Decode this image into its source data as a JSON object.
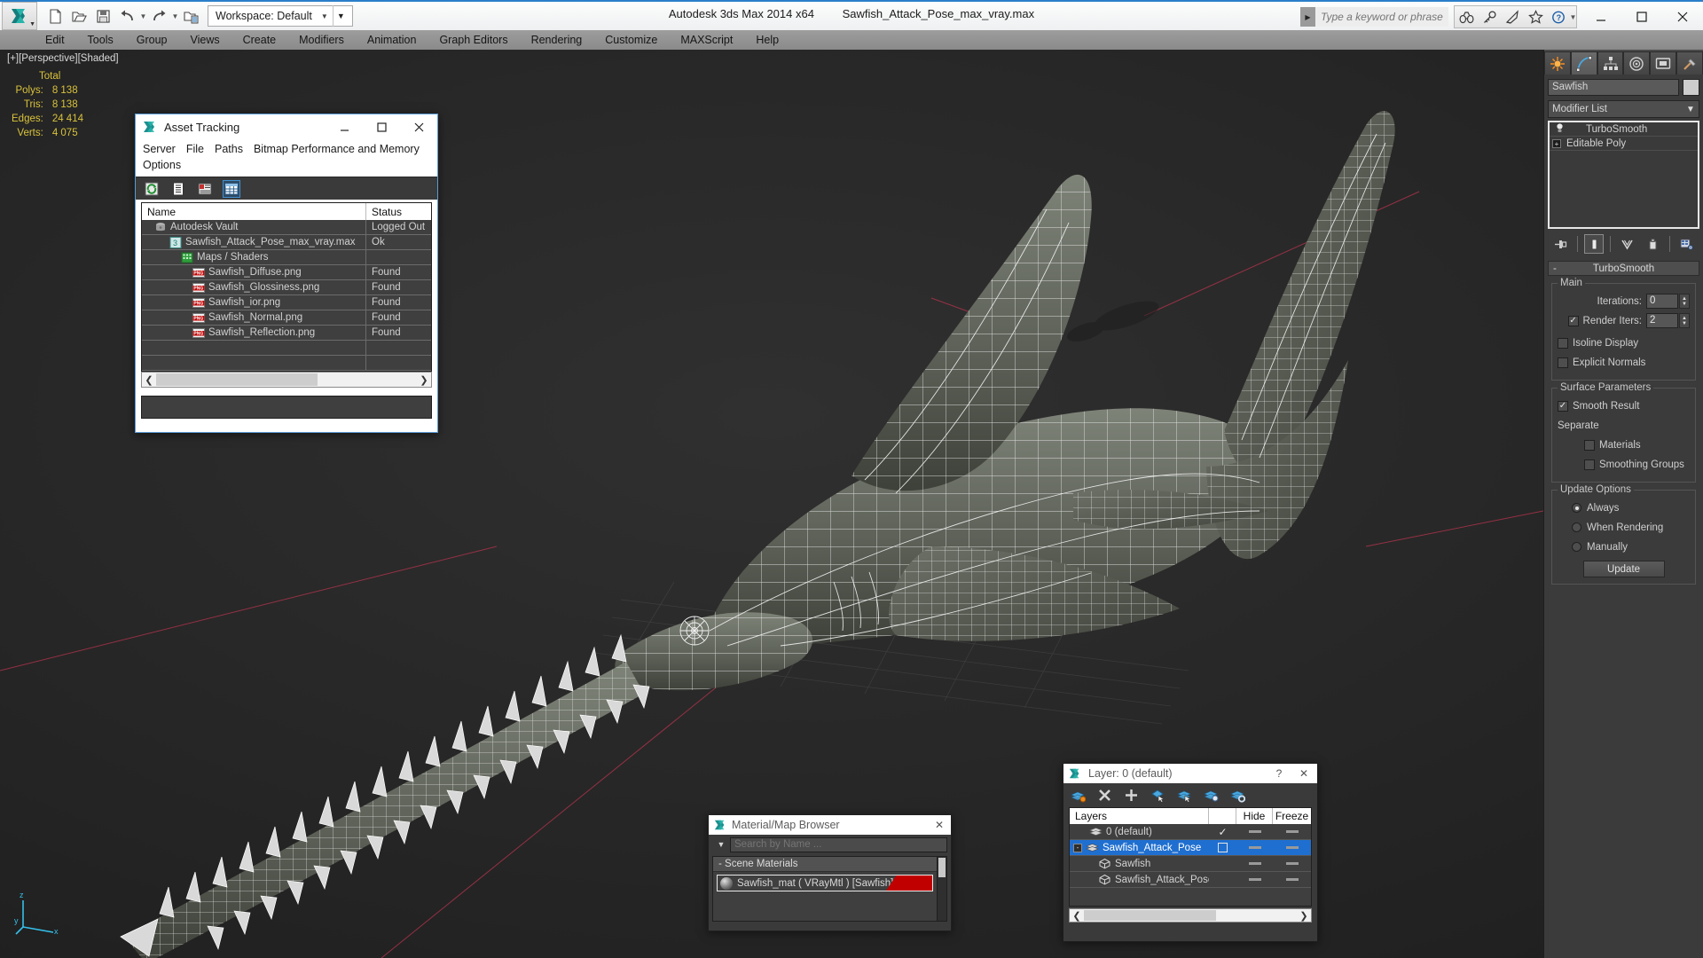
{
  "app": {
    "title": "Autodesk 3ds Max  2014 x64",
    "document": "Sawfish_Attack_Pose_max_vray.max",
    "workspace_label": "Workspace: Default",
    "search_placeholder": "Type a keyword or phrase"
  },
  "quick_access": [
    {
      "name": "new-file-icon",
      "label": "New"
    },
    {
      "name": "open-file-icon",
      "label": "Open"
    },
    {
      "name": "save-file-icon",
      "label": "Save"
    },
    {
      "name": "undo-icon",
      "label": "Undo"
    },
    {
      "name": "redo-icon",
      "label": "Redo"
    },
    {
      "name": "project-folder-icon",
      "label": "Set Project Folder"
    }
  ],
  "title_right_icons": [
    {
      "name": "binoculars-icon",
      "label": "Search"
    },
    {
      "name": "key-icon",
      "label": "Sign In"
    },
    {
      "name": "satellite-dish-icon",
      "label": "Autodesk 360"
    },
    {
      "name": "star-icon",
      "label": "Favorites"
    },
    {
      "name": "help-icon",
      "label": "Help"
    }
  ],
  "window_controls": [
    {
      "name": "minimize-button",
      "glyph": "minimize"
    },
    {
      "name": "maximize-button",
      "glyph": "maximize"
    },
    {
      "name": "close-button",
      "glyph": "close"
    }
  ],
  "menubar": {
    "items": [
      "Edit",
      "Tools",
      "Group",
      "Views",
      "Create",
      "Modifiers",
      "Animation",
      "Graph Editors",
      "Rendering",
      "Customize",
      "MAXScript",
      "Help"
    ]
  },
  "viewport": {
    "label": "[+][Perspective][Shaded]",
    "stats": {
      "header": "Total",
      "rows": [
        {
          "label": "Polys:",
          "value": "8 138"
        },
        {
          "label": "Tris:",
          "value": "8 138"
        },
        {
          "label": "Edges:",
          "value": "24 414"
        },
        {
          "label": "Verts:",
          "value": "4 075"
        }
      ]
    },
    "axis": {
      "x": "x",
      "y": "y",
      "z": "z"
    }
  },
  "asset_tracking": {
    "title": "Asset Tracking",
    "window_buttons": [
      "minimize",
      "maximize",
      "close"
    ],
    "menu": [
      "Server",
      "File",
      "Paths",
      "Bitmap Performance and Memory",
      "Options"
    ],
    "toolbar": [
      {
        "name": "refresh-icon",
        "selected": false
      },
      {
        "name": "list-view-icon",
        "selected": false
      },
      {
        "name": "detail-view-icon",
        "selected": false
      },
      {
        "name": "grid-view-icon",
        "selected": true
      }
    ],
    "columns": [
      "Name",
      "Status"
    ],
    "rows": [
      {
        "name": "Autodesk Vault",
        "status": "Logged Out",
        "icon": "vault-icon",
        "indent": 1
      },
      {
        "name": "Sawfish_Attack_Pose_max_vray.max",
        "status": "Ok",
        "icon": "max-file-icon",
        "indent": 2
      },
      {
        "name": "Maps / Shaders",
        "status": "",
        "icon": "maps-icon",
        "indent": 3
      },
      {
        "name": "Sawfish_Diffuse.png",
        "status": "Found",
        "icon": "png-icon",
        "indent": 4
      },
      {
        "name": "Sawfish_Glossiness.png",
        "status": "Found",
        "icon": "png-icon",
        "indent": 4
      },
      {
        "name": "Sawfish_ior.png",
        "status": "Found",
        "icon": "png-icon",
        "indent": 4
      },
      {
        "name": "Sawfish_Normal.png",
        "status": "Found",
        "icon": "png-icon",
        "indent": 4
      },
      {
        "name": "Sawfish_Reflection.png",
        "status": "Found",
        "icon": "png-icon",
        "indent": 4
      }
    ]
  },
  "material_browser": {
    "title": "Material/Map Browser",
    "search_placeholder": "Search by Name ...",
    "group": "- Scene Materials",
    "items": [
      {
        "name": "Sawfish_mat  ( VRayMtl )  [Sawfish]",
        "color": "#c00000"
      }
    ]
  },
  "layer_manager": {
    "title": "Layer: 0 (default)",
    "columns": [
      "Layers",
      "",
      "Hide",
      "Freeze"
    ],
    "toolbar": [
      {
        "name": "create-new-layer-icon"
      },
      {
        "name": "delete-layer-icon"
      },
      {
        "name": "add-selection-icon"
      },
      {
        "name": "select-objects-icon"
      },
      {
        "name": "select-highlight-icon"
      },
      {
        "name": "layer-properties-icon"
      },
      {
        "name": "layer-settings-icon"
      }
    ],
    "rows": [
      {
        "name": "0 (default)",
        "indent": 1,
        "selected": false,
        "expander": "",
        "active": "check",
        "hide": "dash",
        "freeze": "dash"
      },
      {
        "name": "Sawfish_Attack_Pose",
        "indent": 1,
        "selected": true,
        "expander": "-",
        "active": "box",
        "hide": "dash",
        "freeze": "dash"
      },
      {
        "name": "Sawfish",
        "indent": 2,
        "selected": false,
        "expander": "",
        "active": "",
        "hide": "dash",
        "freeze": "dash"
      },
      {
        "name": "Sawfish_Attack_Pose",
        "indent": 2,
        "selected": false,
        "expander": "",
        "active": "",
        "hide": "dash",
        "freeze": "dash"
      }
    ]
  },
  "command_panel": {
    "tabs": [
      {
        "name": "create-tab",
        "icon": "star-burst-icon",
        "active": false
      },
      {
        "name": "modify-tab",
        "icon": "curve-icon",
        "active": true
      },
      {
        "name": "hierarchy-tab",
        "icon": "hierarchy-icon",
        "active": false
      },
      {
        "name": "motion-tab",
        "icon": "wheel-icon",
        "active": false
      },
      {
        "name": "display-tab",
        "icon": "monitor-icon",
        "active": false
      },
      {
        "name": "utilities-tab",
        "icon": "hammer-icon",
        "active": false
      }
    ],
    "object_name": "Sawfish",
    "object_color": "#cdcdcd",
    "modifier_list_label": "Modifier List",
    "stack": [
      {
        "label": "TurboSmooth",
        "type": "modifier"
      },
      {
        "label": "Editable Poly",
        "type": "base"
      }
    ],
    "stack_buttons": [
      {
        "name": "pin-stack-icon"
      },
      {
        "name": "show-end-result-icon",
        "framed": true
      },
      {
        "name": "make-unique-icon"
      },
      {
        "name": "remove-modifier-icon"
      },
      {
        "name": "configure-modifier-sets-icon"
      }
    ],
    "rollout": {
      "title": "TurboSmooth",
      "groups": [
        {
          "title": "Main",
          "fields": [
            {
              "type": "spinner",
              "label": "Iterations:",
              "value": "0",
              "checkbox": null
            },
            {
              "type": "spinner",
              "label": "Render Iters:",
              "value": "2",
              "checkbox": true
            },
            {
              "type": "checkbox",
              "label": "Isoline Display",
              "checked": false
            },
            {
              "type": "checkbox",
              "label": "Explicit Normals",
              "checked": false
            }
          ]
        },
        {
          "title": "Surface Parameters",
          "fields": [
            {
              "type": "checkbox",
              "label": "Smooth Result",
              "checked": true
            },
            {
              "type": "static",
              "label": "Separate"
            },
            {
              "type": "checkbox-indent",
              "label": "Materials",
              "checked": false
            },
            {
              "type": "checkbox-indent",
              "label": "Smoothing Groups",
              "checked": false
            }
          ]
        },
        {
          "title": "Update Options",
          "fields": [
            {
              "type": "radio",
              "label": "Always",
              "checked": true
            },
            {
              "type": "radio",
              "label": "When Rendering",
              "checked": false
            },
            {
              "type": "radio",
              "label": "Manually",
              "checked": false
            },
            {
              "type": "button",
              "label": "Update"
            }
          ]
        }
      ]
    }
  },
  "colors": {
    "accent_blue": "#2a7fc9",
    "selection_blue": "#1f6fd0",
    "stats_yellow": "#d9c23c",
    "material_red": "#c00000",
    "panel_gray": "#3b3b3b"
  }
}
